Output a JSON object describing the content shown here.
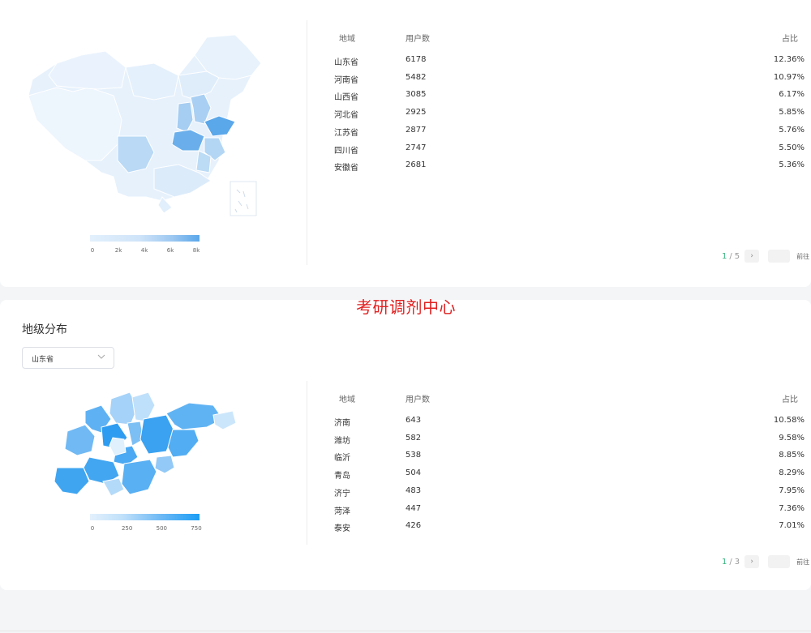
{
  "country": {
    "headers": {
      "region": "地域",
      "users": "用户数",
      "ratio": "占比"
    },
    "rows": [
      {
        "region": "山东省",
        "users": "6178",
        "ratio": "12.36%"
      },
      {
        "region": "河南省",
        "users": "5482",
        "ratio": "10.97%"
      },
      {
        "region": "山西省",
        "users": "3085",
        "ratio": "6.17%"
      },
      {
        "region": "河北省",
        "users": "2925",
        "ratio": "5.85%"
      },
      {
        "region": "江苏省",
        "users": "2877",
        "ratio": "5.76%"
      },
      {
        "region": "四川省",
        "users": "2747",
        "ratio": "5.50%"
      },
      {
        "region": "安徽省",
        "users": "2681",
        "ratio": "5.36%"
      }
    ],
    "legend_ticks": [
      "0",
      "2k",
      "4k",
      "6k",
      "8k"
    ],
    "legend_colors": {
      "low": "#e3f0fc",
      "high": "#5aa7ea"
    },
    "pager": {
      "current": "1",
      "separator": "/",
      "total": "5",
      "jump_label": "前往"
    }
  },
  "watermark": "考研调剂中心",
  "city_section": {
    "title": "地级分布",
    "select_value": "山东省",
    "headers": {
      "region": "地域",
      "users": "用户数",
      "ratio": "占比"
    },
    "rows": [
      {
        "region": "济南",
        "users": "643",
        "ratio": "10.58%"
      },
      {
        "region": "潍坊",
        "users": "582",
        "ratio": "9.58%"
      },
      {
        "region": "临沂",
        "users": "538",
        "ratio": "8.85%"
      },
      {
        "region": "青岛",
        "users": "504",
        "ratio": "8.29%"
      },
      {
        "region": "济宁",
        "users": "483",
        "ratio": "7.95%"
      },
      {
        "region": "菏泽",
        "users": "447",
        "ratio": "7.36%"
      },
      {
        "region": "泰安",
        "users": "426",
        "ratio": "7.01%"
      }
    ],
    "legend_ticks": [
      "0",
      "250",
      "500",
      "750"
    ],
    "legend_colors": {
      "low": "#e3f0fc",
      "high": "#1a9df5"
    },
    "pager": {
      "current": "1",
      "separator": "/",
      "total": "3",
      "jump_label": "前往"
    }
  },
  "colors": {
    "accent_green": "#35b37e",
    "watermark_red": "#e02020"
  }
}
